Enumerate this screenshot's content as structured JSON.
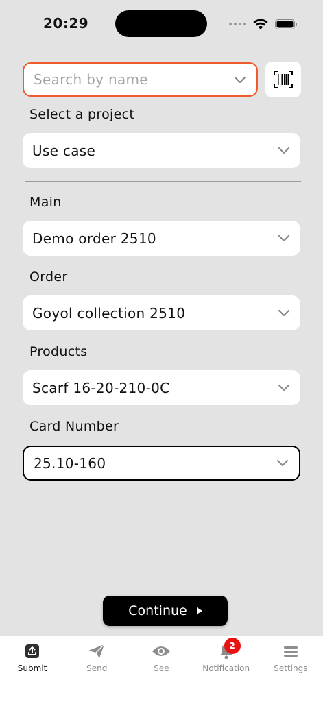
{
  "status_bar": {
    "time": "20:29"
  },
  "search": {
    "placeholder": "Search by name"
  },
  "project": {
    "label": "Select a project",
    "value": "Use case"
  },
  "main": {
    "label": "Main",
    "value": "Demo order 2510"
  },
  "order": {
    "label": "Order",
    "value": "Goyol collection 2510"
  },
  "products": {
    "label": "Products",
    "value": "Scarf 16-20-210-0C"
  },
  "card": {
    "label": "Card Number",
    "value": "25.10-160"
  },
  "continue_label": "Continue",
  "tabs": [
    {
      "label": "Submit",
      "icon": "upload-icon",
      "active": true
    },
    {
      "label": "Send",
      "icon": "paper-plane-icon"
    },
    {
      "label": "See",
      "icon": "eye-icon"
    },
    {
      "label": "Notification",
      "icon": "bell-icon",
      "badge": "2"
    },
    {
      "label": "Settings",
      "icon": "menu-icon"
    }
  ],
  "colors": {
    "accent": "#ef5b2b",
    "badge": "#e81212",
    "background": "#e3e3e3"
  }
}
